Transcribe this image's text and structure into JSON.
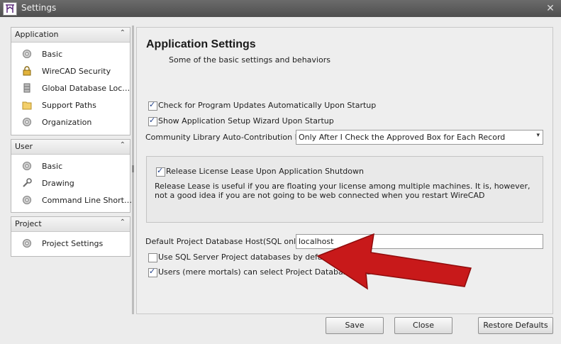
{
  "window": {
    "title": "Settings",
    "close_glyph": "✕"
  },
  "sidebar": {
    "groups": [
      {
        "label": "Application",
        "collapse_glyph": "⌃",
        "items": [
          {
            "label": "Basic",
            "icon": "gear-icon"
          },
          {
            "label": "WireCAD Security",
            "icon": "lock-icon"
          },
          {
            "label": "Global Database Loc…",
            "icon": "database-icon"
          },
          {
            "label": "Support Paths",
            "icon": "folder-icon"
          },
          {
            "label": "Organization",
            "icon": "gear-icon"
          }
        ]
      },
      {
        "label": "User",
        "collapse_glyph": "⌃",
        "items": [
          {
            "label": "Basic",
            "icon": "gear-icon"
          },
          {
            "label": "Drawing",
            "icon": "wrench-icon"
          },
          {
            "label": "Command Line Short…",
            "icon": "gear-icon"
          }
        ]
      },
      {
        "label": "Project",
        "collapse_glyph": "⌃",
        "items": [
          {
            "label": "Project Settings",
            "icon": "gear-icon"
          }
        ]
      }
    ]
  },
  "main": {
    "title": "Application Settings",
    "subtitle": "Some of the basic settings and behaviors",
    "check_updates": {
      "label": "Check for Program Updates Automatically Upon Startup",
      "checked": true
    },
    "show_wizard": {
      "label": "Show Application Setup Wizard Upon Startup",
      "checked": true
    },
    "community_library": {
      "label": "Community Library Auto-Contribution Mode",
      "value": "Only After I Check the Approved Box for Each Record"
    },
    "release_license": {
      "label": "Release License Lease Upon Application Shutdown",
      "checked": true,
      "description": "Release Lease is useful if you are floating your license among multiple machines. It is, however, not a good idea if you are not going to be web connected when you restart WireCAD"
    },
    "db_host": {
      "label": "Default Project Database Host(SQL only)",
      "value": "localhost"
    },
    "use_sql": {
      "label": "Use SQL Server Project databases by default",
      "checked": false
    },
    "users_select": {
      "label": "Users (mere mortals) can select Project Database Mode",
      "checked": true
    }
  },
  "footer": {
    "save": "Save",
    "close": "Close",
    "restore": "Restore Defaults"
  },
  "colors": {
    "annotation_arrow": "#c8191a"
  }
}
